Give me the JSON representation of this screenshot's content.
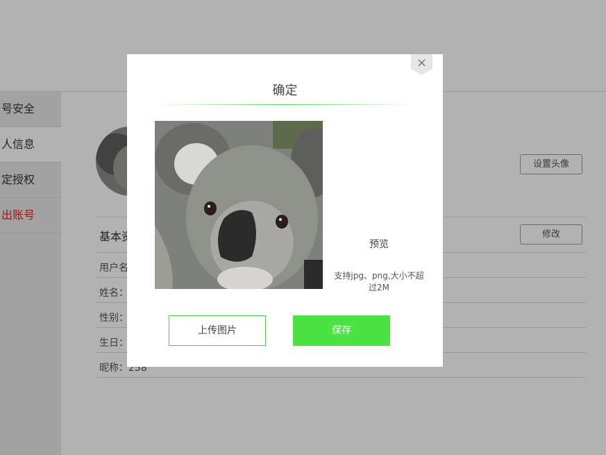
{
  "sidebar": {
    "items": [
      {
        "label": "号安全"
      },
      {
        "label": "人信息"
      },
      {
        "label": "定授权"
      },
      {
        "label": "出账号"
      }
    ]
  },
  "profile": {
    "set_avatar_label": "设置头像",
    "section_title": "基本资",
    "edit_label": "修改",
    "fields": [
      {
        "label": "用户名"
      },
      {
        "label": "姓名："
      },
      {
        "label": "性别："
      },
      {
        "label": "生日："
      },
      {
        "label": "昵称：258"
      }
    ]
  },
  "modal": {
    "title": "确定",
    "close_glyph": "×",
    "preview_label": "预览",
    "hint": "支持jpg、png,大小不超过2M",
    "upload_label": "上传图片",
    "save_label": "保存"
  },
  "colors": {
    "accent": "#4be244",
    "accent_border": "#4bc948",
    "danger": "#e02020"
  },
  "icons": {
    "close": "close-icon"
  }
}
